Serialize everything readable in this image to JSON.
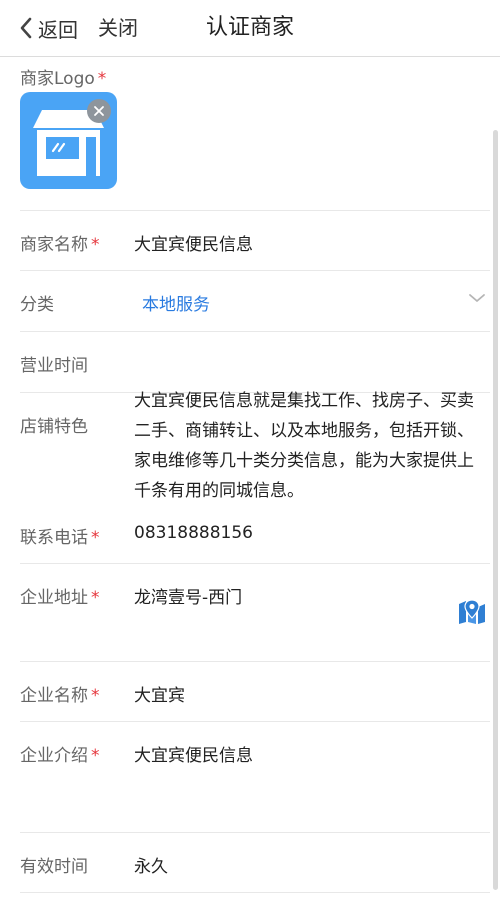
{
  "nav": {
    "back_label": "返回",
    "close_label": "关闭",
    "title": "认证商家"
  },
  "logo": {
    "label": "商家Logo",
    "required_mark": "*",
    "image_icon": "shop-icon",
    "remove_icon": "close-icon",
    "image_color": "#4aa4f5"
  },
  "fields": {
    "merchant_name": {
      "label": "商家名称",
      "required_mark": "*",
      "value": "大宜宾便民信息"
    },
    "category": {
      "label": "分类",
      "value": "本地服务",
      "icon": "chevron-down-icon",
      "value_color": "#2a7be0"
    },
    "business_hours": {
      "label": "营业时间",
      "value": ""
    },
    "features": {
      "label": "店铺特色",
      "value": "大宜宾便民信息就是集找工作、找房子、买卖二手、商铺转让、以及本地服务，包括开锁、家电维修等几十类分类信息，能为大家提供上千条有用的同城信息。"
    },
    "phone": {
      "label": "联系电话",
      "required_mark": "*",
      "value": "08318888156"
    },
    "address": {
      "label": "企业地址",
      "required_mark": "*",
      "value": "龙湾壹号-西门",
      "icon": "map-pin-icon"
    },
    "company_name": {
      "label": "企业名称",
      "required_mark": "*",
      "value": "大宜宾"
    },
    "company_intro": {
      "label": "企业介绍",
      "required_mark": "*",
      "value": "大宜宾便民信息"
    },
    "validity": {
      "label": "有效时间",
      "value": "永久"
    }
  },
  "colors": {
    "required": "#e5363d",
    "accent": "#2a7be0",
    "label": "#666666"
  }
}
